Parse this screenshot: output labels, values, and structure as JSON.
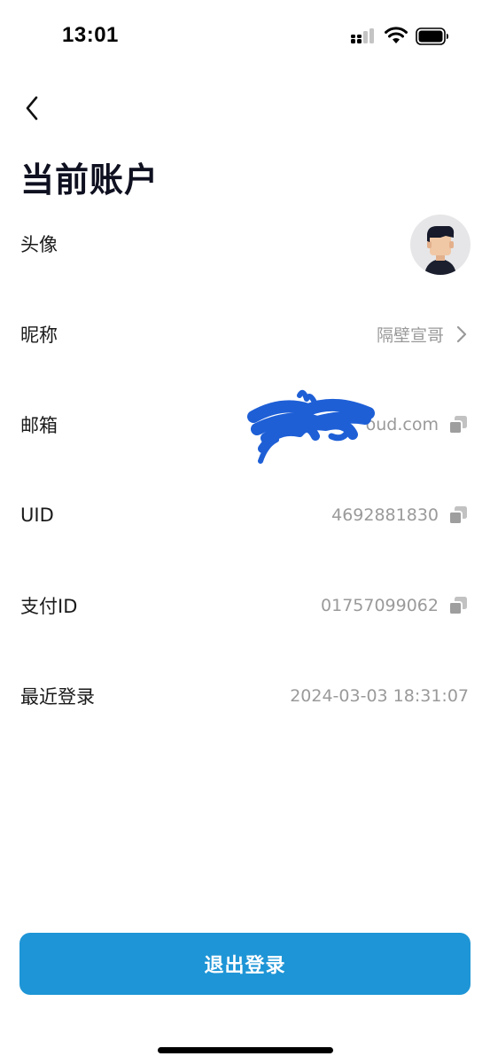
{
  "status_bar": {
    "time": "13:01",
    "icons": [
      "signal-icon",
      "wifi-icon",
      "battery-icon"
    ]
  },
  "header": {
    "back_icon": "chevron-left-icon",
    "title": "当前账户"
  },
  "rows": {
    "avatar": {
      "label": "头像"
    },
    "nickname": {
      "label": "昵称",
      "value": "隔壁宣哥"
    },
    "email": {
      "label": "邮箱",
      "value": "oud.com"
    },
    "uid": {
      "label": "UID",
      "value": "4692881830"
    },
    "pay_id": {
      "label": "支付ID",
      "value": "01757099062"
    },
    "last_login": {
      "label": "最近登录",
      "value": "2024-03-03 18:31:07"
    }
  },
  "logout": {
    "label": "退出登录"
  },
  "colors": {
    "accent": "#1e95d6",
    "value_text": "#9a9a9a",
    "scribble": "#1e5fd6"
  }
}
